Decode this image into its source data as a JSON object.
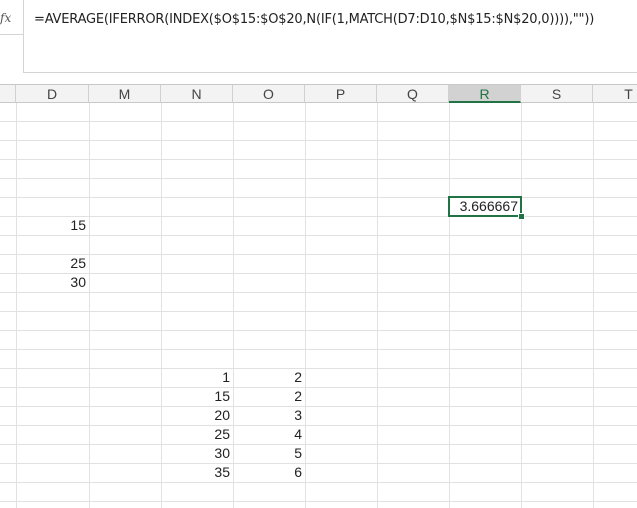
{
  "formula_bar": {
    "fx_label": "fx",
    "formula": "=AVERAGE(IFERROR(INDEX($O$15:$O$20,N(IF(1,MATCH(D7:D10,$N$15:$N$20,0)))),\"\"))"
  },
  "columns": {
    "d": "D",
    "m": "M",
    "n": "N",
    "o": "O",
    "p": "P",
    "q": "Q",
    "r": "R",
    "s": "S",
    "t": "T"
  },
  "cells": {
    "r6": "3.666667",
    "d7": "15",
    "d9": "25",
    "d10": "30",
    "n15": "1",
    "o15": "2",
    "n16": "15",
    "o16": "2",
    "n17": "20",
    "o17": "3",
    "n18": "25",
    "o18": "4",
    "n19": "30",
    "o19": "5",
    "n20": "35",
    "o20": "6"
  },
  "colors": {
    "selection": "#217346",
    "header_bg": "#f3f3f3",
    "gridline": "#e1e1e1"
  }
}
